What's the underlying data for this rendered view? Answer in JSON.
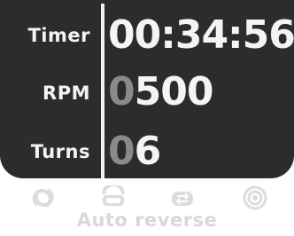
{
  "display": {
    "timer_label": "Timer",
    "timer_value": "00:34:56",
    "rpm_label": "RPM",
    "rpm_value_dim": "0",
    "rpm_value": "500",
    "turns_label": "Turns",
    "turns_value_dim": "0",
    "turns_value": "6"
  },
  "modes": {
    "icons": [
      "cycle-icon",
      "oscillate-icon",
      "reverse-icon",
      "rotate-icon"
    ],
    "selected_label": "Auto reverse"
  },
  "colors": {
    "panel": "#2c2c2c",
    "text": "#f4f4f4",
    "dim_digit": "#8a8a8a",
    "inactive": "#d8d8d8"
  }
}
